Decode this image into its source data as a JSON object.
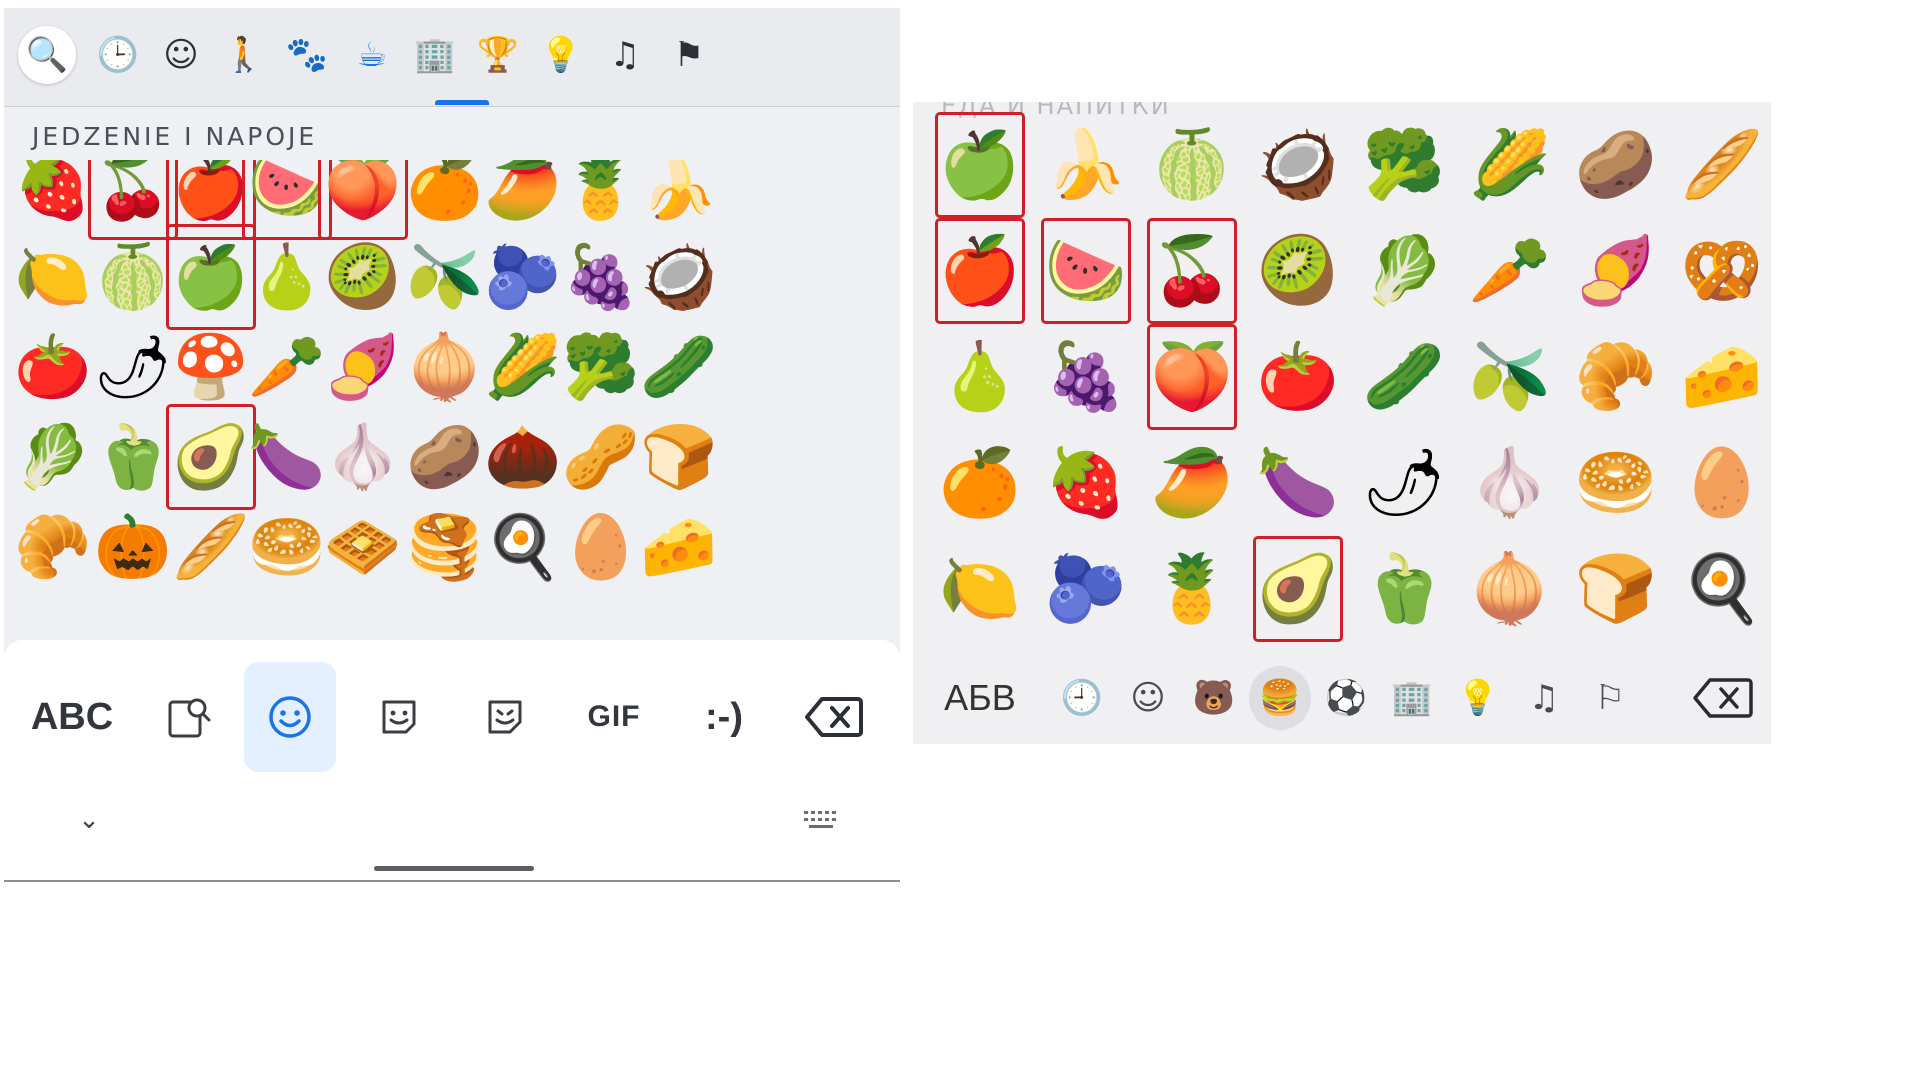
{
  "left_keyboard": {
    "tabs": [
      {
        "icon": "search-icon",
        "glyph": "🔍"
      },
      {
        "icon": "recent-clock-icon",
        "glyph": "🕒"
      },
      {
        "icon": "smiley-icon",
        "glyph": "☺"
      },
      {
        "icon": "person-activity-icon",
        "glyph": "🚶"
      },
      {
        "icon": "animals-icon",
        "glyph": "🐾"
      },
      {
        "icon": "food-drink-icon",
        "glyph": "☕"
      },
      {
        "icon": "travel-places-icon",
        "glyph": "🏢"
      },
      {
        "icon": "trophy-icon",
        "glyph": "🏆"
      },
      {
        "icon": "lightbulb-icon",
        "glyph": "💡"
      },
      {
        "icon": "symbols-icon",
        "glyph": "♫"
      },
      {
        "icon": "flag-icon",
        "glyph": "⚑"
      }
    ],
    "active_tab": "food-drink-icon",
    "accent_color": "#1a73e8",
    "section_title": "JEDZENIE I NAPOJE",
    "rows": [
      [
        {
          "e": "🍓",
          "name": "strawberry",
          "hl": false
        },
        {
          "e": "🍒",
          "name": "cherries",
          "hl": true
        },
        {
          "e": "🍎",
          "name": "red-apple",
          "hl": true
        },
        {
          "e": "🍉",
          "name": "watermelon",
          "hl": true
        },
        {
          "e": "🍑",
          "name": "peach",
          "hl": true
        },
        {
          "e": "🍊",
          "name": "tangerine",
          "hl": false
        },
        {
          "e": "🥭",
          "name": "mango",
          "hl": false
        },
        {
          "e": "🍍",
          "name": "pineapple",
          "hl": false
        },
        {
          "e": "🍌",
          "name": "banana",
          "hl": false
        }
      ],
      [
        {
          "e": "🍋",
          "name": "lemon",
          "hl": false
        },
        {
          "e": "🍈",
          "name": "melon",
          "hl": false
        },
        {
          "e": "🍏",
          "name": "green-apple",
          "hl": true
        },
        {
          "e": "🍐",
          "name": "pear",
          "hl": false
        },
        {
          "e": "🥝",
          "name": "kiwi",
          "hl": false
        },
        {
          "e": "🫒",
          "name": "olive",
          "hl": false
        },
        {
          "e": "🫐",
          "name": "blueberries",
          "hl": false
        },
        {
          "e": "🍇",
          "name": "grapes",
          "hl": false
        },
        {
          "e": "🥥",
          "name": "coconut",
          "hl": false
        }
      ],
      [
        {
          "e": "🍅",
          "name": "tomato",
          "hl": false
        },
        {
          "e": "🌶",
          "name": "hot-pepper",
          "hl": false
        },
        {
          "e": "🍄",
          "name": "mushroom",
          "hl": false
        },
        {
          "e": "🥕",
          "name": "carrot",
          "hl": false
        },
        {
          "e": "🍠",
          "name": "sweet-potato",
          "hl": false
        },
        {
          "e": "🧅",
          "name": "onion",
          "hl": false
        },
        {
          "e": "🌽",
          "name": "corn",
          "hl": false
        },
        {
          "e": "🥦",
          "name": "broccoli",
          "hl": false
        },
        {
          "e": "🥒",
          "name": "cucumber",
          "hl": false
        }
      ],
      [
        {
          "e": "🥬",
          "name": "leafy-green",
          "hl": false
        },
        {
          "e": "🫑",
          "name": "bell-pepper",
          "hl": false
        },
        {
          "e": "🥑",
          "name": "avocado",
          "hl": true
        },
        {
          "e": "🍆",
          "name": "eggplant",
          "hl": false
        },
        {
          "e": "🧄",
          "name": "garlic",
          "hl": false
        },
        {
          "e": "🥔",
          "name": "potato",
          "hl": false
        },
        {
          "e": "🌰",
          "name": "chestnut",
          "hl": false
        },
        {
          "e": "🥜",
          "name": "peanuts",
          "hl": false
        },
        {
          "e": "🍞",
          "name": "bread",
          "hl": false
        }
      ],
      [
        {
          "e": "🥐",
          "name": "croissant",
          "hl": false
        },
        {
          "e": "🎃",
          "name": "pumpkin",
          "hl": false
        },
        {
          "e": "🥖",
          "name": "baguette",
          "hl": false
        },
        {
          "e": "🥯",
          "name": "bagel",
          "hl": false
        },
        {
          "e": "🧇",
          "name": "waffle",
          "hl": false
        },
        {
          "e": "🥞",
          "name": "pancakes",
          "hl": false
        },
        {
          "e": "🍳",
          "name": "cooking",
          "hl": false
        },
        {
          "e": "🥚",
          "name": "egg",
          "hl": false
        },
        {
          "e": "🧀",
          "name": "cheese",
          "hl": false
        }
      ]
    ],
    "bottom_bar": {
      "abc_label": "ABC",
      "gif_label": "GIF",
      "emoticon_label": ":-)",
      "collapse_glyph": "⌄"
    }
  },
  "right_keyboard": {
    "section_title": "ЕДА И НАПИТКИ",
    "rows": [
      [
        {
          "e": "🍏",
          "name": "green-apple",
          "hl": true
        },
        {
          "e": "🍌",
          "name": "banana",
          "hl": false
        },
        {
          "e": "🍈",
          "name": "melon",
          "hl": false
        },
        {
          "e": "🥥",
          "name": "coconut",
          "hl": false
        },
        {
          "e": "🥦",
          "name": "broccoli",
          "hl": false
        },
        {
          "e": "🌽",
          "name": "corn",
          "hl": false
        },
        {
          "e": "🥔",
          "name": "potato",
          "hl": false
        },
        {
          "e": "🥖",
          "name": "baguette",
          "hl": false
        }
      ],
      [
        {
          "e": "🍎",
          "name": "red-apple",
          "hl": true
        },
        {
          "e": "🍉",
          "name": "watermelon",
          "hl": true
        },
        {
          "e": "🍒",
          "name": "cherries",
          "hl": true
        },
        {
          "e": "🥝",
          "name": "kiwi",
          "hl": false
        },
        {
          "e": "🥬",
          "name": "leafy-green",
          "hl": false
        },
        {
          "e": "🥕",
          "name": "carrot",
          "hl": false
        },
        {
          "e": "🍠",
          "name": "sweet-potato",
          "hl": false
        },
        {
          "e": "🥨",
          "name": "pretzel",
          "hl": false
        }
      ],
      [
        {
          "e": "🍐",
          "name": "pear",
          "hl": false
        },
        {
          "e": "🍇",
          "name": "grapes",
          "hl": false
        },
        {
          "e": "🍑",
          "name": "peach",
          "hl": true
        },
        {
          "e": "🍅",
          "name": "tomato",
          "hl": false
        },
        {
          "e": "🥒",
          "name": "cucumber",
          "hl": false
        },
        {
          "e": "🫒",
          "name": "olive",
          "hl": false
        },
        {
          "e": "🥐",
          "name": "croissant",
          "hl": false
        },
        {
          "e": "🧀",
          "name": "cheese",
          "hl": false
        }
      ],
      [
        {
          "e": "🍊",
          "name": "tangerine",
          "hl": false
        },
        {
          "e": "🍓",
          "name": "strawberry",
          "hl": false
        },
        {
          "e": "🥭",
          "name": "mango",
          "hl": false
        },
        {
          "e": "🍆",
          "name": "eggplant",
          "hl": false
        },
        {
          "e": "🌶",
          "name": "hot-pepper",
          "hl": false
        },
        {
          "e": "🧄",
          "name": "garlic",
          "hl": false
        },
        {
          "e": "🥯",
          "name": "bagel",
          "hl": false
        },
        {
          "e": "🥚",
          "name": "egg",
          "hl": false
        }
      ],
      [
        {
          "e": "🍋",
          "name": "lemon",
          "hl": false
        },
        {
          "e": "🫐",
          "name": "blueberries",
          "hl": false
        },
        {
          "e": "🍍",
          "name": "pineapple",
          "hl": false
        },
        {
          "e": "🥑",
          "name": "avocado",
          "hl": true
        },
        {
          "e": "🫑",
          "name": "bell-pepper",
          "hl": false
        },
        {
          "e": "🧅",
          "name": "onion",
          "hl": false
        },
        {
          "e": "🍞",
          "name": "bread",
          "hl": false
        },
        {
          "e": "🍳",
          "name": "cooking",
          "hl": false
        }
      ]
    ],
    "bottom_bar": {
      "abc_label": "АБВ",
      "icons": [
        {
          "icon": "recent-clock-icon",
          "glyph": "🕘"
        },
        {
          "icon": "smiley-icon",
          "glyph": "☺"
        },
        {
          "icon": "animals-icon",
          "glyph": "🐻"
        },
        {
          "icon": "food-drink-icon",
          "glyph": "🍔",
          "active": true
        },
        {
          "icon": "soccer-ball-icon",
          "glyph": "⚽"
        },
        {
          "icon": "travel-places-icon",
          "glyph": "🏢"
        },
        {
          "icon": "lightbulb-icon",
          "glyph": "💡"
        },
        {
          "icon": "symbols-icon",
          "glyph": "♫"
        },
        {
          "icon": "flag-icon",
          "glyph": "⚐"
        }
      ]
    }
  },
  "highlight_color": "#d11f26"
}
